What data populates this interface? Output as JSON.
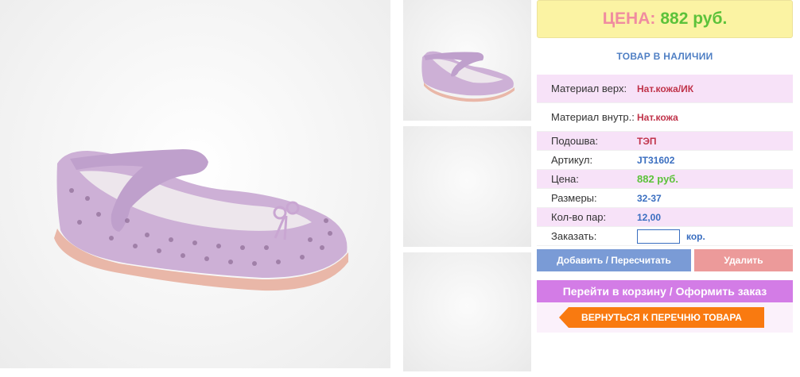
{
  "product": {
    "price_label": "ЦЕНА:",
    "price_value": "882 руб.",
    "stock_status": "ТОВАР В НАЛИЧИИ",
    "specs": [
      {
        "key": "Материал верх:",
        "value": "Нат.кожа/ИК"
      },
      {
        "key": "Материал внутр.:",
        "value": "Нат.кожа"
      },
      {
        "key": "Подошва:",
        "value": "ТЭП"
      },
      {
        "key": "Артикул:",
        "value": "JT31602"
      },
      {
        "key": "Цена:",
        "value": "882 руб."
      },
      {
        "key": "Размеры:",
        "value": "32-37"
      },
      {
        "key": "Кол-во пар:",
        "value": "12,00"
      }
    ],
    "order_label": "Заказать:",
    "order_unit": "кор.",
    "order_value": ""
  },
  "actions": {
    "add_label": "Добавить / Пересчитать",
    "delete_label": "Удалить",
    "cart_label": "Перейти в корзину / Оформить заказ",
    "back_label": "ВЕРНУТЬСЯ К ПЕРЕЧНЮ ТОВАРА"
  },
  "colors": {
    "price_box": "#fbf3a3",
    "stock_text": "#4f7fc4",
    "row_highlight": "#f7e2f8",
    "add_button": "#7a9bd6",
    "delete_button": "#ec9a9a",
    "cart_button": "#d37ce6",
    "back_button": "#f97a10"
  }
}
